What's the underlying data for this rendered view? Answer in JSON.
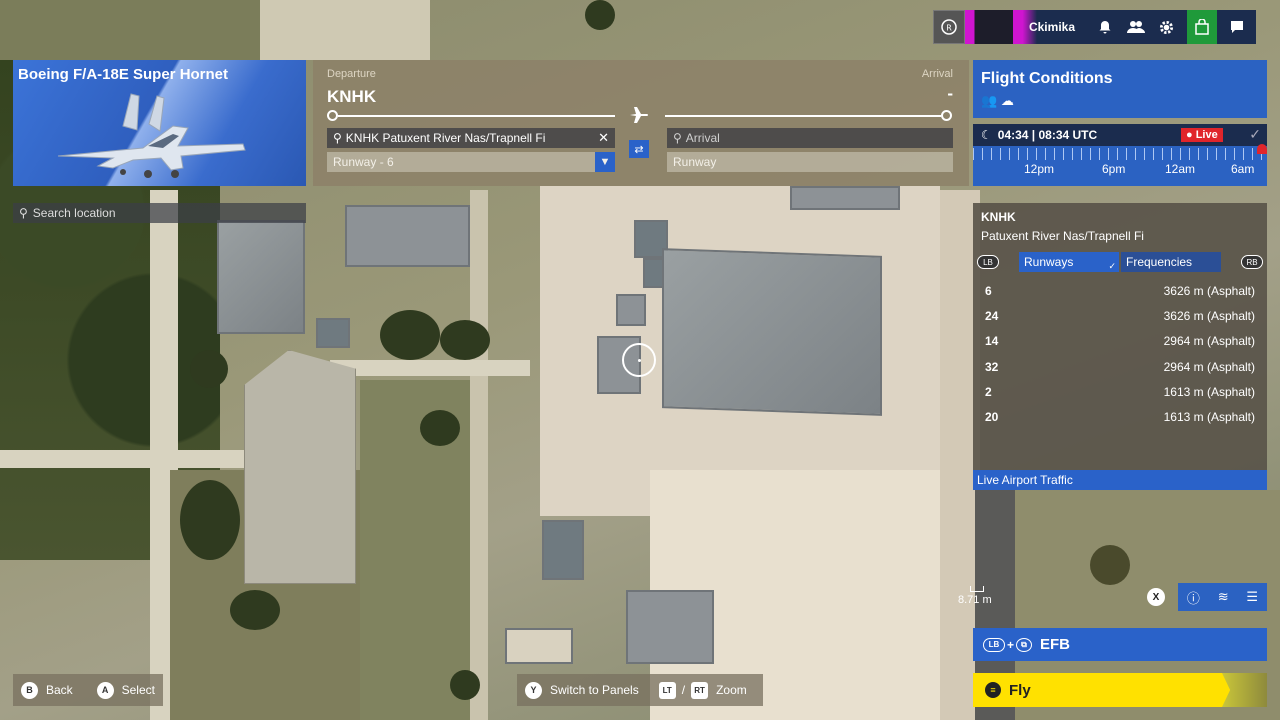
{
  "topbar": {
    "username": "Ckimika",
    "icons": [
      "rank-badge-icon",
      "bell-icon",
      "friends-icon",
      "gear-icon",
      "marketplace-icon",
      "chat-icon"
    ]
  },
  "aircraft": {
    "name": "Boeing F/A-18E Super Hornet"
  },
  "route": {
    "departure_label": "Departure",
    "arrival_label": "Arrival",
    "departure_icao": "KNHK",
    "arrival_icao": "-",
    "departure_search_value": "KNHK Patuxent River Nas/Trapnell Fi",
    "departure_runway": "Runway - 6",
    "arrival_placeholder": "Arrival",
    "arrival_runway_placeholder": "Runway"
  },
  "search_location": {
    "placeholder": "Search location"
  },
  "flight_conditions": {
    "title": "Flight Conditions",
    "time": "04:34 | 08:34 UTC",
    "live_label": "Live",
    "tick_labels": [
      "12pm",
      "6pm",
      "12am",
      "6am"
    ]
  },
  "airport": {
    "icao": "KNHK",
    "name": "Patuxent River Nas/Trapnell Fi",
    "lb": "LB",
    "rb": "RB",
    "tabs": [
      "Runways",
      "Frequencies"
    ],
    "runways": [
      {
        "id": "6",
        "info": "3626 m (Asphalt)"
      },
      {
        "id": "24",
        "info": "3626 m (Asphalt)"
      },
      {
        "id": "14",
        "info": "2964 m (Asphalt)"
      },
      {
        "id": "32",
        "info": "2964 m (Asphalt)"
      },
      {
        "id": "2",
        "info": "1613 m (Asphalt)"
      },
      {
        "id": "20",
        "info": "1613 m (Asphalt)"
      }
    ],
    "live_traffic": "Live Airport Traffic"
  },
  "map": {
    "scale_label": "8.71 m",
    "x_button": "X"
  },
  "actions": {
    "efb_label": "EFB",
    "efb_lb": "LB",
    "efb_plus": "+",
    "fly_label": "Fly"
  },
  "hints": {
    "back_key": "B",
    "back_label": "Back",
    "select_key": "A",
    "select_label": "Select",
    "panels_key": "Y",
    "panels_label": "Switch to Panels",
    "lt_key": "LT",
    "slash": "/",
    "rt_key": "RT",
    "zoom_label": "Zoom"
  }
}
